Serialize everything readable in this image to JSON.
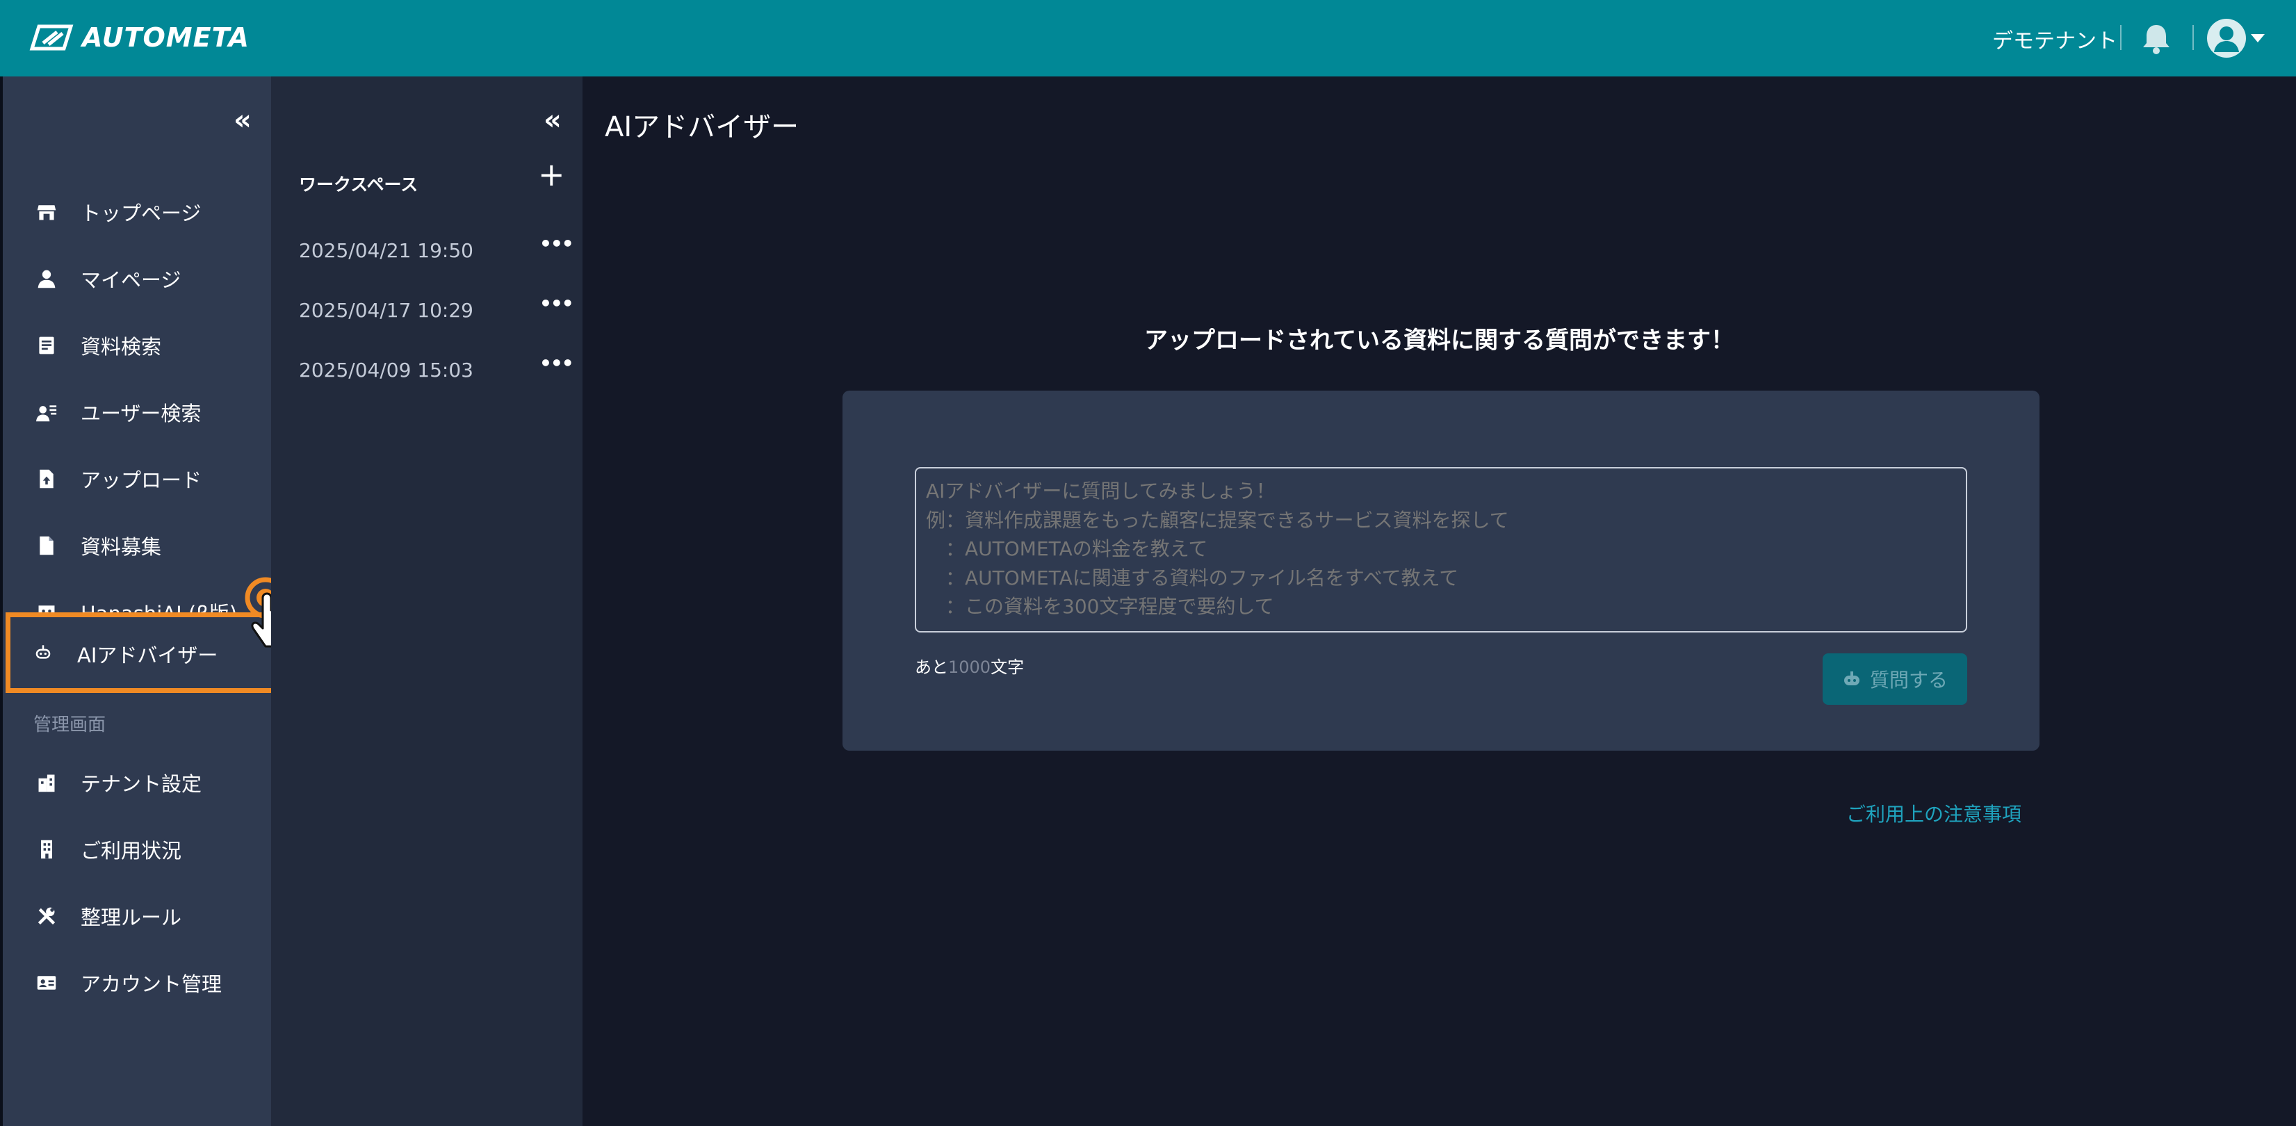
{
  "header": {
    "brand": "AUTOMETA",
    "tenant": "デモテナント",
    "icons": [
      "logo-icon",
      "bell-icon",
      "user-avatar-icon",
      "chevron-down-icon"
    ]
  },
  "sidebar": {
    "collapse": "«",
    "items": [
      {
        "label": "トップページ",
        "icon": "store-icon"
      },
      {
        "label": "マイページ",
        "icon": "person-icon"
      },
      {
        "label": "資料検索",
        "icon": "document-search-icon"
      },
      {
        "label": "ユーザー検索",
        "icon": "user-search-icon"
      },
      {
        "label": "アップロード",
        "icon": "file-upload-icon"
      },
      {
        "label": "資料募集",
        "icon": "file-icon"
      },
      {
        "label": "HanashiAI (β版)",
        "icon": "chat-bot-icon"
      },
      {
        "label": "AIアドバイザー",
        "icon": "robot-icon",
        "active": true
      }
    ],
    "admin_section": "管理画面",
    "admin_items": [
      {
        "label": "テナント設定",
        "icon": "building-settings-icon"
      },
      {
        "label": "ご利用状況",
        "icon": "building-icon"
      },
      {
        "label": "整理ルール",
        "icon": "tools-icon"
      },
      {
        "label": "アカウント管理",
        "icon": "id-card-icon"
      }
    ]
  },
  "workspace": {
    "collapse": "«",
    "title": "ワークスペース",
    "add": "+",
    "more": "•••",
    "items": [
      "2025/04/21 19:50",
      "2025/04/17 10:29",
      "2025/04/09 15:03"
    ]
  },
  "main": {
    "title": "AIアドバイザー",
    "heading": "アップロードされている資料に関する質問ができます！",
    "placeholder": "AIアドバイザーに質問してみましょう！\n例：資料作成課題をもった顧客に提案できるサービス資料を探して\n　：AUTOMETAの料金を教えて\n　：AUTOMETAに関連する資料のファイル名をすべて教えて\n　：この資料を300文字程度で要約して",
    "counter_prefix": "あと",
    "counter_value": "1000",
    "counter_suffix": "文字",
    "ask_button": "質問する",
    "notice_link": "ご利用上の注意事項"
  },
  "colors": {
    "header": "#018896",
    "sidebar": "#2f3a50",
    "workspace_panel": "#222a3c",
    "main_bg": "#141827",
    "active_highlight": "#f08a24",
    "link": "#1fa3be"
  }
}
